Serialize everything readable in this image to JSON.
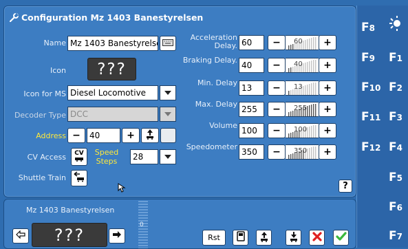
{
  "dialog": {
    "title": "Configuration Mz 1403 Banestyrelsen",
    "name_label": "Name",
    "name_value": "Mz 1403 Banestyrelsen",
    "icon_label": "Icon",
    "icon_text": "???",
    "icon_ms_label": "Icon for MS",
    "icon_ms_value": "Diesel Locomotive",
    "decoder_label": "Decoder Type",
    "decoder_value": "DCC",
    "address_label": "Address",
    "address_value": "40",
    "cv_label": "CV Access",
    "cv_button": "CV",
    "speed_steps_label": "Speed Steps",
    "speed_steps_value": "28",
    "shuttle_label": "Shuttle Train",
    "help": "?",
    "params": [
      {
        "label": "Acceleration Delay.",
        "value": "60",
        "slider": "60",
        "level": 0.24
      },
      {
        "label": "Braking Delay.",
        "value": "40",
        "slider": "40",
        "level": 0.16
      },
      {
        "label": "Min. Delay",
        "value": "13",
        "slider": "13",
        "level": 0.05
      },
      {
        "label": "Max. Delay",
        "value": "255",
        "slider": "255",
        "level": 1.0
      },
      {
        "label": "Volume",
        "value": "100",
        "slider": "100",
        "level": 0.45
      },
      {
        "label": "Speedometer",
        "value": "350",
        "slider": "350",
        "level": 0.55
      }
    ],
    "minus": "−",
    "plus": "+"
  },
  "rightbar": {
    "keys": [
      {
        "main": "F",
        "sub": "8"
      },
      {
        "main": "F",
        "sub": "9"
      },
      {
        "main": "F",
        "sub": "10"
      },
      {
        "main": "F",
        "sub": "11"
      },
      {
        "main": "F",
        "sub": "12"
      },
      {
        "main": "F",
        "sub": "1"
      },
      {
        "main": "F",
        "sub": "2"
      },
      {
        "main": "F",
        "sub": "3"
      },
      {
        "main": "F",
        "sub": "4"
      },
      {
        "main": "F",
        "sub": "5"
      },
      {
        "main": "F",
        "sub": "6"
      },
      {
        "main": "F",
        "sub": "7"
      }
    ]
  },
  "bottom": {
    "loco_name": "Mz 1403 Banestyrelsen",
    "icon_text": "???",
    "speed_value": "0",
    "rst_label": "Rst"
  },
  "colors": {
    "accent": "#3d7dc2",
    "ok": "#3cb83c",
    "cancel": "#e02020"
  }
}
